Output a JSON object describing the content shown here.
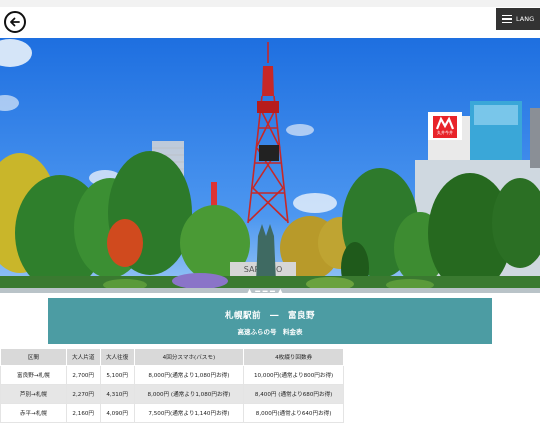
{
  "header": {
    "back_icon": "back-arrow-icon",
    "menu_icon": "hamburger-menu-icon",
    "lang_label": "LANG"
  },
  "hero": {
    "sign_text": "SAPPORO",
    "building_sign": "丸井今井"
  },
  "route": {
    "title": "札幌駅前　―　富良野",
    "subtitle": "高速ふらの号　料金表"
  },
  "fare_table": {
    "headers": [
      "区間",
      "大人片道",
      "大人往復",
      "4回分スマホ(バスモ)",
      "4枚綴り回数券"
    ],
    "rows": [
      [
        "富良野→札幌",
        "2,700円",
        "5,100円",
        "8,000円(通常より1,080円お得)",
        "10,000円(通常より800円お得)"
      ],
      [
        "芦別→札幌",
        "2,270円",
        "4,310円",
        "8,000円 (通常より1,080円お得)",
        "8,400円 (通常より680円お得)"
      ],
      [
        "赤平→札幌",
        "2,160円",
        "4,090円",
        "7,500円(通常より1,140円お得)",
        "8,000円(通常より640円お得)"
      ]
    ]
  }
}
